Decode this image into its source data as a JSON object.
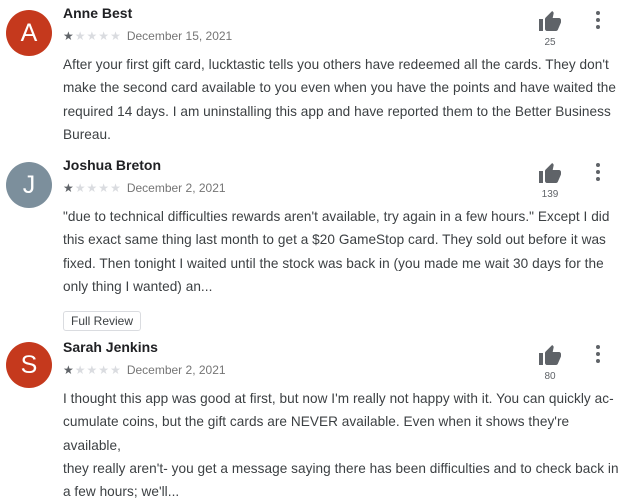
{
  "colors": {
    "avatar_a": "#c5391d",
    "avatar_j": "#7c8f9c",
    "avatar_s": "#c5391d"
  },
  "star_filled": "★",
  "star_empty": "★",
  "reviews": [
    {
      "initial": "A",
      "name": "Anne Best",
      "rating": 1,
      "date": "December 15, 2021",
      "helpful_count": "25",
      "text": [
        "After your first gift card, lucktastic tells you others have redeemed all the cards. They don't",
        "make the second card available to you even when you have the points and have waited the",
        "required 14 days. I am uninstalling this app and have reported them to the Better Business",
        "Bureau."
      ]
    },
    {
      "initial": "J",
      "name": "Joshua Breton",
      "rating": 1,
      "date": "December 2, 2021",
      "helpful_count": "139",
      "text": [
        "\"due to technical difficulties rewards aren't available, try again in a few hours.\" Except I did",
        "this exact same thing last month to get a $20 GameStop card. They sold out before it was",
        "fixed. Then tonight I waited until the stock was back in (you made me wait 30 days for the",
        "only thing I wanted) an..."
      ],
      "full_review_label": "Full Review"
    },
    {
      "initial": "S",
      "name": "Sarah Jenkins",
      "rating": 1,
      "date": "December 2, 2021",
      "helpful_count": "80",
      "text": [
        "I thought this app was good at first, but now I'm really not happy with it. You can quickly ac-",
        "cumulate coins, but the gift cards are NEVER available. Even when it shows they're available,",
        "they really aren't- you get a message saying there has been difficulties and to check back in",
        "a few hours; we'll..."
      ]
    }
  ]
}
